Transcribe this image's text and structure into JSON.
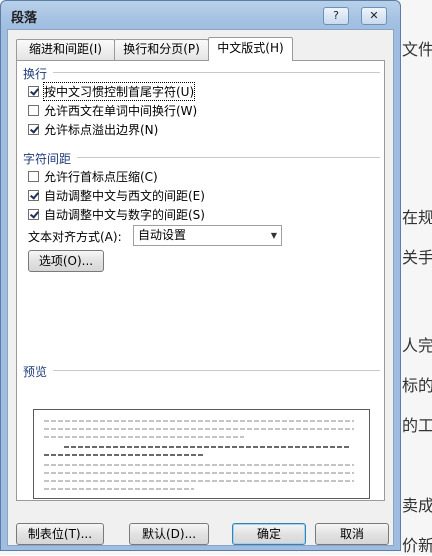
{
  "window": {
    "title": "段落",
    "help_label": "?",
    "close_label": "✕"
  },
  "tabs": [
    {
      "label": "缩进和间距(I)",
      "active": false
    },
    {
      "label": "换行和分页(P)",
      "active": false
    },
    {
      "label": "中文版式(H)",
      "active": true
    }
  ],
  "line_break": {
    "label": "换行",
    "options": [
      {
        "label": "按中文习惯控制首尾字符(U)",
        "checked": true
      },
      {
        "label": "允许西文在单词中间换行(W)",
        "checked": false
      },
      {
        "label": "允许标点溢出边界(N)",
        "checked": true
      }
    ]
  },
  "char_spacing": {
    "label": "字符间距",
    "options": [
      {
        "label": "允许行首标点压缩(C)",
        "checked": false
      },
      {
        "label": "自动调整中文与西文的间距(E)",
        "checked": true
      },
      {
        "label": "自动调整中文与数字的间距(S)",
        "checked": true
      }
    ],
    "align_label": "文本对齐方式(A):",
    "align_value": "自动设置",
    "options_button": "选项(O)..."
  },
  "preview": {
    "label": "预览"
  },
  "footer": {
    "tabs_button": "制表位(T)...",
    "default_button": "默认(D)...",
    "ok_button": "确定",
    "cancel_button": "取消"
  },
  "background_doc": {
    "lines": [
      "文件",
      "在规",
      "关手",
      "人完",
      "标的",
      "的工",
      "卖成",
      "价新"
    ]
  },
  "colors": {
    "accent": "#1f3d7a",
    "titlebar": "#a6c2e2"
  }
}
